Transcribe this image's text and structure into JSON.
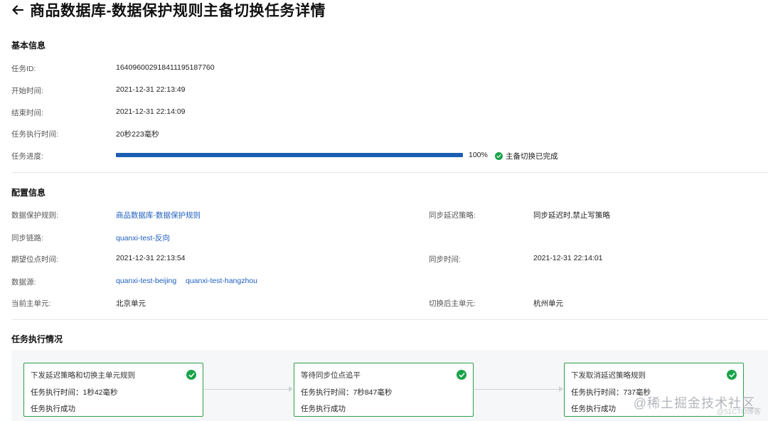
{
  "header": {
    "title": "商品数据库-数据保护规则主备切换任务详情"
  },
  "basic": {
    "section_title": "基本信息",
    "task_id_label": "任务ID:",
    "task_id": "1640960029184111951877​60",
    "start_label": "开始时间:",
    "start": "2021-12-31 22:13:49",
    "end_label": "结束时间:",
    "end": "2021-12-31 22:14:09",
    "duration_label": "任务执行时间:",
    "duration": "20秒223毫秒",
    "progress_label": "任务进度:",
    "progress_value": 100,
    "progress_text": "100%",
    "status_text": "主备切换已完成"
  },
  "config": {
    "section_title": "配置信息",
    "rule_label": "数据保护规则:",
    "rule_value": "商品数据库-数据保护规则",
    "delay_policy_label": "同步延迟策略:",
    "delay_policy_value": "同步延迟时,禁止写策略",
    "link_label": "同步链路:",
    "link_value": "quanxi-test-反向",
    "expect_time_label": "期望位点时间:",
    "expect_time_value": "2021-12-31 22:13:54",
    "sync_time_label": "同步时间:",
    "sync_time_value": "2021-12-31 22:14:01",
    "source_label": "数据源:",
    "source_1": "quanxi-test-beijing",
    "source_2": "quanxi-test-hangzhou",
    "current_unit_label": "当前主单元:",
    "current_unit_value": "北京单元",
    "after_unit_label": "切换后主单元:",
    "after_unit_value": "杭州单元"
  },
  "execution": {
    "section_title": "任务执行情况",
    "steps": [
      {
        "title": "下发延迟策略和切换主单元规则",
        "time": "任务执行时间：1秒42毫秒",
        "result": "任务执行成功"
      },
      {
        "title": "等待同步位点追平",
        "time": "任务执行时间：7秒847毫秒",
        "result": "任务执行成功"
      },
      {
        "title": "下发取消延迟策略规则",
        "time": "任务执行时间：737毫秒",
        "result": "任务执行成功"
      }
    ]
  },
  "watermark": {
    "text": "@稀土掘金技术社区",
    "sub": "@51CTO博客"
  },
  "colors": {
    "accent": "#1a5fb4",
    "link": "#1f5fbf",
    "success": "#1aa34a",
    "card_border": "#2e9f4a"
  },
  "icons": {
    "back": "arrow-left-icon",
    "status": "check-circle-icon",
    "step": "check-circle-icon"
  }
}
